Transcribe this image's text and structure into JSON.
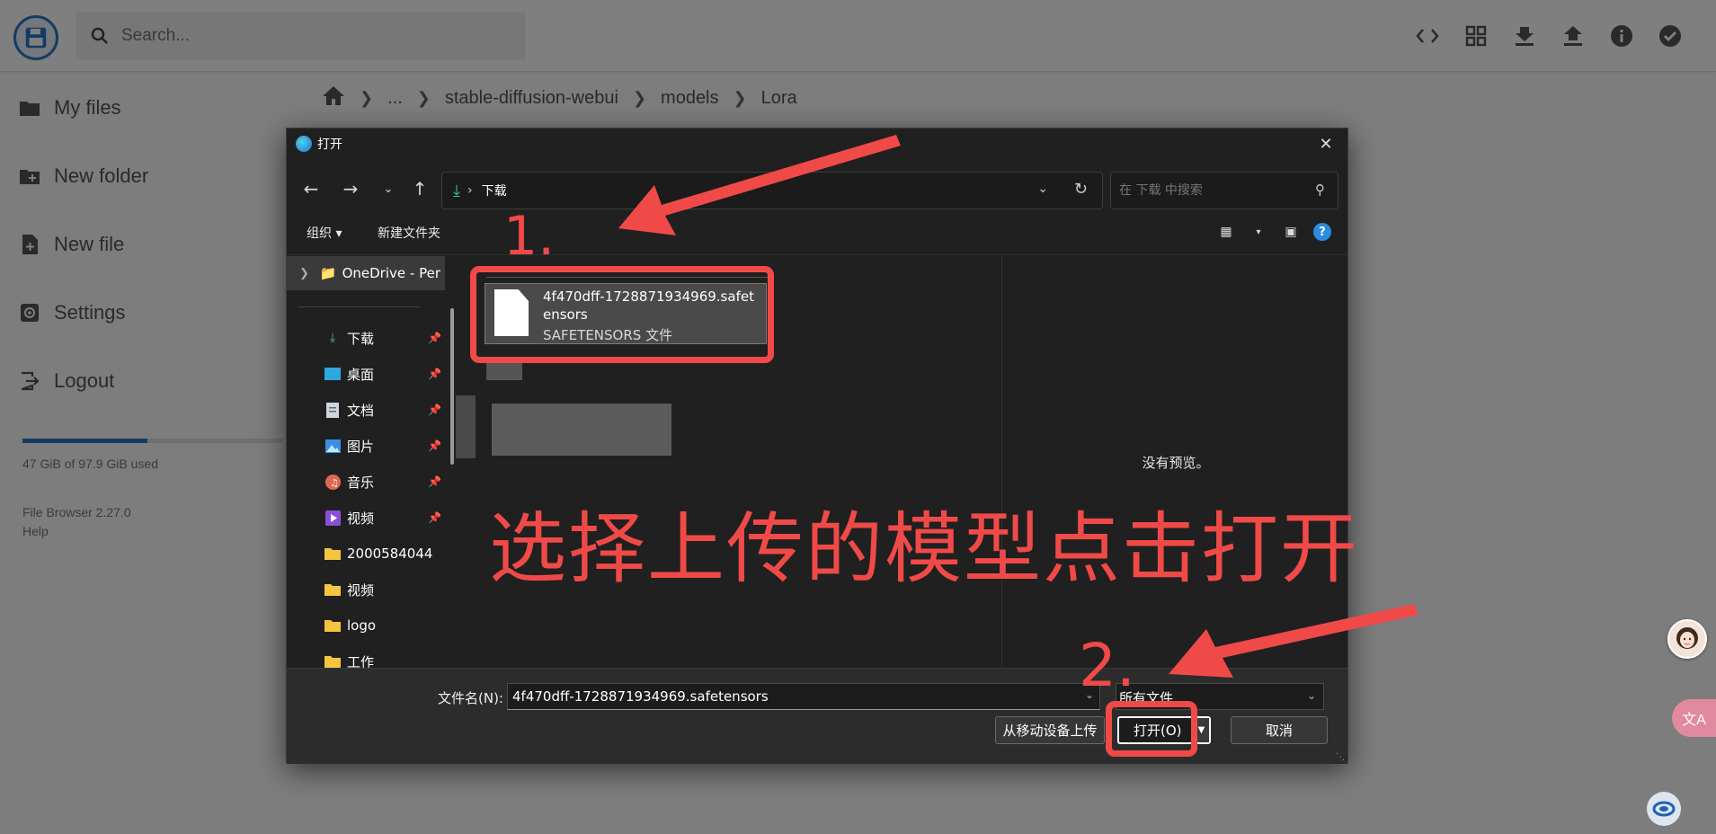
{
  "app": {
    "search_placeholder": "Search...",
    "sidebar": [
      {
        "label": "My files",
        "icon": "folder-icon"
      },
      {
        "label": "New folder",
        "icon": "new-folder-icon"
      },
      {
        "label": "New file",
        "icon": "new-file-icon"
      },
      {
        "label": "Settings",
        "icon": "gear-icon"
      },
      {
        "label": "Logout",
        "icon": "logout-icon"
      }
    ],
    "usage_text": "47 GiB of 97.9 GiB used",
    "usage_fraction": 0.48,
    "version": "File Browser 2.27.0",
    "help": "Help",
    "breadcrumb": [
      "...",
      "stable-diffusion-webui",
      "models",
      "Lora"
    ],
    "accent": "#2979c7"
  },
  "dialog": {
    "title": "打开",
    "address_folder": "下载",
    "search_placeholder": "在 下载 中搜索",
    "organize": "组织",
    "new_folder": "新建文件夹",
    "nav": {
      "onedrive": "OneDrive - Per",
      "items": [
        {
          "label": "下载",
          "icon": "download-icon",
          "pinned": true
        },
        {
          "label": "桌面",
          "icon": "desktop-icon",
          "pinned": true
        },
        {
          "label": "文档",
          "icon": "document-icon",
          "pinned": true
        },
        {
          "label": "图片",
          "icon": "picture-icon",
          "pinned": true
        },
        {
          "label": "音乐",
          "icon": "music-icon",
          "pinned": true
        },
        {
          "label": "视频",
          "icon": "video-icon",
          "pinned": true
        },
        {
          "label": "2000584044",
          "icon": "folder-icon",
          "pinned": false
        },
        {
          "label": "视频",
          "icon": "folder-icon",
          "pinned": false
        },
        {
          "label": "logo",
          "icon": "folder-icon",
          "pinned": false
        },
        {
          "label": "工作",
          "icon": "folder-icon",
          "pinned": false
        }
      ]
    },
    "file": {
      "name": "4f470dff-1728871934969.safetensors",
      "type": "SAFETENSORS 文件"
    },
    "preview_text": "没有预览。",
    "filename_label": "文件名(N):",
    "filename_value": "4f470dff-1728871934969.safetensors",
    "filter": "所有文件",
    "upload_mobile": "从移动设备上传",
    "open": "打开(O)",
    "cancel": "取消"
  },
  "annotations": {
    "step1": "1.",
    "step2": "2.",
    "instruction": "选择上传的模型点击打开",
    "color": "#f04a48"
  }
}
